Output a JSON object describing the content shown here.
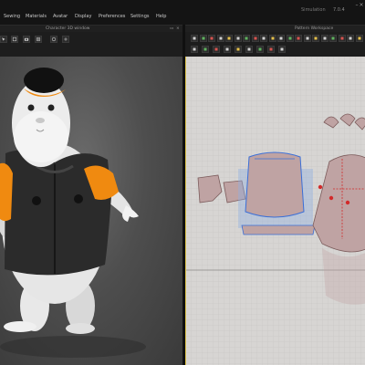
{
  "app": {
    "version_text": "7.0.4",
    "menu": [
      "Sewing",
      "Materials",
      "Avatar",
      "Display",
      "Preferences",
      "Settings",
      "Help"
    ],
    "right_label": "Simulation"
  },
  "left_panel": {
    "title": "Character 3D window"
  },
  "right_panel": {
    "title": "Pattern Workspace"
  },
  "colors": {
    "accent_orange": "#f08a10",
    "pattern_fill": "#bfa3a3",
    "selection_blue": "#3a6fd8",
    "grid_bg": "#d7d5d3"
  },
  "icons": {
    "left_toolbar": [
      "select-icon",
      "transform-icon",
      "camera-icon",
      "grid-icon",
      "view-icon",
      "settings-icon",
      "gizmo-icon",
      "fit-icon"
    ],
    "right_toolbar_row1": [
      "select-pattern-icon",
      "transform-pattern-icon",
      "edit-point-icon",
      "edit-curve-icon",
      "add-point-icon",
      "rectangle-icon",
      "polygon-icon",
      "internal-line-icon",
      "ellipse-icon",
      "seam-icon",
      "fold-icon",
      "arrange-icon",
      "unlock-icon",
      "pin-icon",
      "tape-icon",
      "pleat-icon",
      "mirror-icon",
      "grid-icon",
      "display-icon",
      "color-icon"
    ],
    "right_toolbar_row2": [
      "segment-sewing-icon",
      "free-sewing-icon",
      "check-sewing-icon",
      "auto-sewing-icon",
      "tack-icon",
      "trim-icon",
      "button-icon",
      "zipper-icon",
      "topstitch-icon"
    ]
  }
}
